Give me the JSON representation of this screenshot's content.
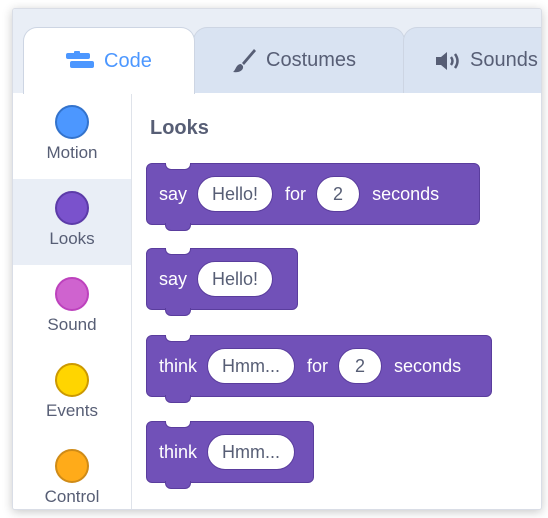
{
  "tabs": {
    "code": "Code",
    "costumes": "Costumes",
    "sounds": "Sounds"
  },
  "categories": [
    {
      "label": "Motion",
      "color": "#4c97ff",
      "border": "#3373cc"
    },
    {
      "label": "Looks",
      "color": "#9966ff",
      "border": "#774dcb"
    },
    {
      "label": "Sound",
      "color": "#cf63cf",
      "border": "#bd42bd"
    },
    {
      "label": "Events",
      "color": "#ffd500",
      "border": "#cc9900"
    },
    {
      "label": "Control",
      "color": "#ffab19",
      "border": "#cf8b17"
    }
  ],
  "palette": {
    "heading": "Looks",
    "blocks": [
      {
        "word1": "say",
        "text": "Hello!",
        "for": "for",
        "num": "2",
        "unit": "seconds"
      },
      {
        "word1": "say",
        "text": "Hello!"
      },
      {
        "word1": "think",
        "text": "Hmm...",
        "for": "for",
        "num": "2",
        "unit": "seconds"
      },
      {
        "word1": "think",
        "text": "Hmm..."
      }
    ]
  },
  "colors": {
    "looks_block": "#7151b8",
    "accent": "#4c97ff",
    "tab_bar": "#e9eef6"
  }
}
